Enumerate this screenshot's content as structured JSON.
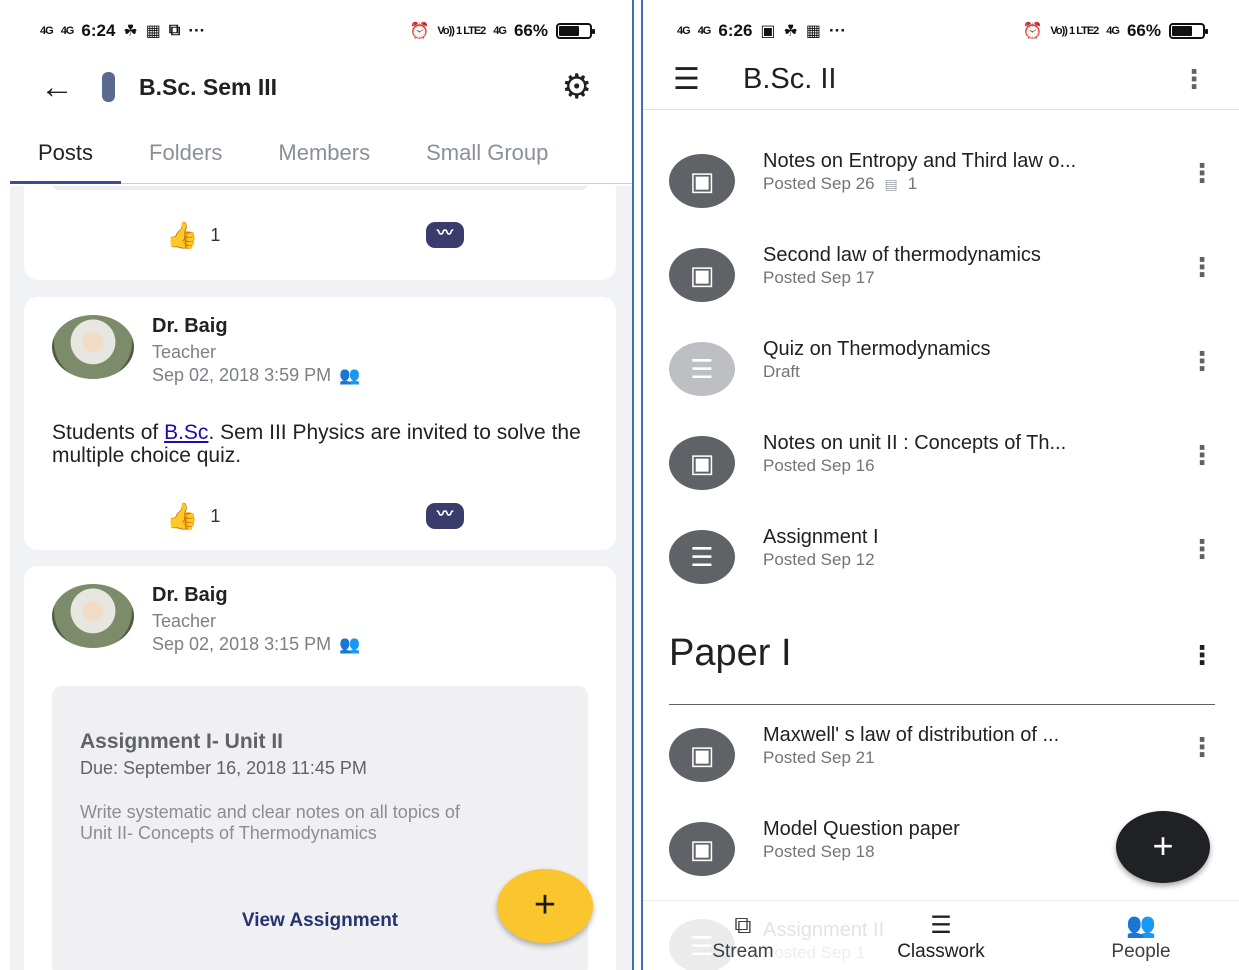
{
  "left": {
    "status": {
      "net1": "4G",
      "net2": "4G",
      "time": "6:24",
      "more": "···",
      "lte": "Vo)) 1 LTE2",
      "net3": "4G",
      "battery": "66%",
      "battery_level": 0.66
    },
    "header": {
      "title": "B.Sc. Sem III"
    },
    "tabs": [
      "Posts",
      "Folders",
      "Members",
      "Small Group"
    ],
    "active_tab": "Posts",
    "posts": [
      {
        "likes": "1"
      },
      {
        "author": "Dr. Baig",
        "role": "Teacher",
        "date": "Sep 02, 2018 3:59 PM",
        "text_before": "Students of ",
        "link": "B.Sc",
        "text_after": ". Sem III Physics are invited to solve the multiple choice quiz.",
        "likes": "1"
      },
      {
        "author": "Dr. Baig",
        "role": "Teacher",
        "date": "Sep 02, 2018 3:15 PM",
        "assignment": {
          "title": "Assignment I- Unit II",
          "due": "Due: September 16, 2018 11:45 PM",
          "description": "Write systematic and clear notes on all topics of Unit II- Concepts of Thermodynamics",
          "action": "View Assignment"
        }
      }
    ],
    "fab": "+"
  },
  "right": {
    "status": {
      "net1": "4G",
      "net2": "4G",
      "time": "6:26",
      "more": "···",
      "lte": "Vo)) 1 LTE2",
      "net3": "4G",
      "battery": "66%",
      "battery_level": 0.66
    },
    "header": {
      "title": "B.Sc. II"
    },
    "items": [
      {
        "title": "Notes on Entropy and Third law o...",
        "sub": "Posted Sep 26",
        "comments": "1",
        "icon": "material-icon"
      },
      {
        "title": "Second law of thermodynamics",
        "sub": "Posted Sep 17",
        "icon": "material-icon"
      },
      {
        "title": "Quiz on Thermodynamics",
        "sub": "Draft",
        "icon": "assignment-icon"
      },
      {
        "title": "Notes on unit II : Concepts of Th...",
        "sub": "Posted Sep 16",
        "icon": "material-icon"
      },
      {
        "title": "Assignment I",
        "sub": "Posted Sep 12",
        "icon": "assignment-icon"
      }
    ],
    "topic": "Paper I",
    "topic_items": [
      {
        "title": "Maxwell' s law of distribution of ...",
        "sub": "Posted Sep 21",
        "icon": "material-icon"
      },
      {
        "title": "Model Question paper",
        "sub": "Posted Sep 18",
        "icon": "material-icon"
      }
    ],
    "ghost_item": {
      "title": "Assignment II",
      "sub": "Posted Sep 1"
    },
    "fab": "+",
    "nav": [
      "Stream",
      "Classwork",
      "People"
    ]
  }
}
